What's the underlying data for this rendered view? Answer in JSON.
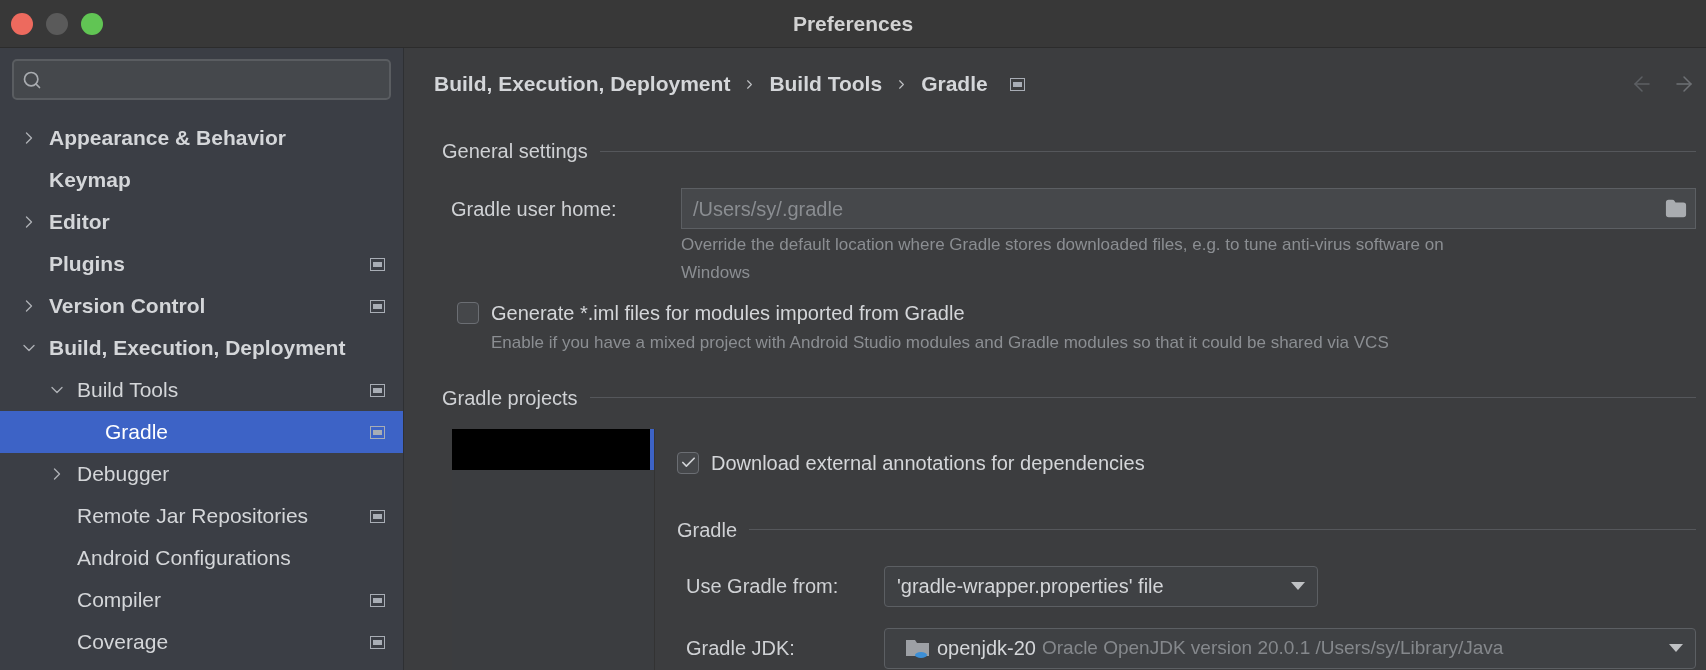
{
  "window": {
    "title": "Preferences"
  },
  "sidebar": {
    "items": [
      {
        "label": "Appearance & Behavior",
        "expandable": true,
        "expanded": false,
        "selected": false,
        "project_icon": false
      },
      {
        "label": "Keymap",
        "expandable": false,
        "selected": false,
        "project_icon": false
      },
      {
        "label": "Editor",
        "expandable": true,
        "expanded": false,
        "selected": false,
        "project_icon": false
      },
      {
        "label": "Plugins",
        "expandable": false,
        "selected": false,
        "project_icon": true
      },
      {
        "label": "Version Control",
        "expandable": true,
        "expanded": false,
        "selected": false,
        "project_icon": true
      },
      {
        "label": "Build, Execution, Deployment",
        "expandable": true,
        "expanded": true,
        "selected": false,
        "project_icon": false,
        "children": [
          {
            "label": "Build Tools",
            "expandable": true,
            "expanded": true,
            "selected": false,
            "project_icon": true,
            "children": [
              {
                "label": "Gradle",
                "expandable": false,
                "selected": true,
                "project_icon": true
              }
            ]
          },
          {
            "label": "Debugger",
            "expandable": true,
            "expanded": false,
            "selected": false,
            "project_icon": false
          },
          {
            "label": "Remote Jar Repositories",
            "expandable": false,
            "selected": false,
            "project_icon": true
          },
          {
            "label": "Android Configurations",
            "expandable": false,
            "selected": false,
            "project_icon": false
          },
          {
            "label": "Compiler",
            "expandable": false,
            "selected": false,
            "project_icon": true
          },
          {
            "label": "Coverage",
            "expandable": false,
            "selected": false,
            "project_icon": true
          }
        ]
      }
    ]
  },
  "breadcrumb": [
    "Build, Execution, Deployment",
    "Build Tools",
    "Gradle"
  ],
  "general": {
    "title": "General settings",
    "user_home_label": "Gradle user home:",
    "user_home_value": "/Users/sy/.gradle",
    "user_home_hint": "Override the default location where Gradle stores downloaded files, e.g. to tune anti-virus software on Windows",
    "generate_iml": {
      "label": "Generate *.iml files for modules imported from Gradle",
      "checked": false,
      "hint": "Enable if you have a mixed project with Android Studio modules and Gradle modules so that it could be shared via VCS"
    }
  },
  "projects": {
    "title": "Gradle projects",
    "download_annotations": {
      "label": "Download external annotations for dependencies",
      "checked": true
    },
    "gradle_title": "Gradle",
    "use_from_label": "Use Gradle from:",
    "use_from_value": "'gradle-wrapper.properties' file",
    "jdk_label": "Gradle JDK:",
    "jdk_name": "openjdk-20",
    "jdk_detail": "Oracle OpenJDK version 20.0.1 /Users/sy/Library/Java"
  }
}
